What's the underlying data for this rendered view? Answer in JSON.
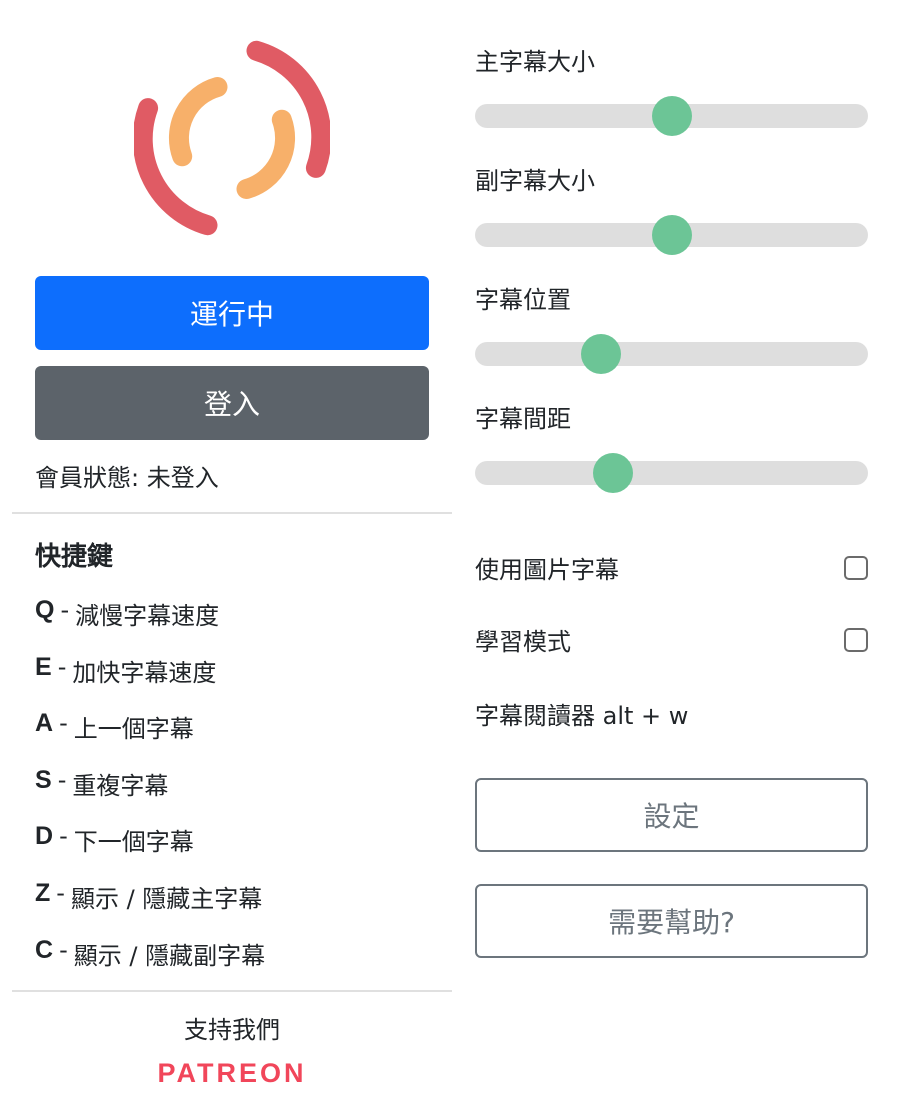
{
  "buttons": {
    "run_label": "運行中",
    "login_label": "登入"
  },
  "member": {
    "label": "會員狀態:",
    "value": "未登入"
  },
  "shortcuts": {
    "title": "快捷鍵",
    "items": [
      {
        "key": "Q",
        "desc": "減慢字幕速度"
      },
      {
        "key": "E",
        "desc": "加快字幕速度"
      },
      {
        "key": "A",
        "desc": "上一個字幕"
      },
      {
        "key": "S",
        "desc": "重複字幕"
      },
      {
        "key": "D",
        "desc": "下一個字幕"
      },
      {
        "key": "Z",
        "desc": "顯示 / 隱藏主字幕"
      },
      {
        "key": "C",
        "desc": "顯示 / 隱藏副字幕"
      }
    ]
  },
  "support": {
    "text": "支持我們",
    "brand": "PATREON"
  },
  "sliders": [
    {
      "label": "主字幕大小",
      "value": 0.5
    },
    {
      "label": "副字幕大小",
      "value": 0.5
    },
    {
      "label": "字幕位置",
      "value": 0.32
    },
    {
      "label": "字幕間距",
      "value": 0.35
    }
  ],
  "options": {
    "image_subtitle": {
      "label": "使用圖片字幕",
      "checked": false
    },
    "learning_mode": {
      "label": "學習模式",
      "checked": false
    },
    "reader_label": "字幕閱讀器 alt + w"
  },
  "right_buttons": {
    "settings_label": "設定",
    "help_label": "需要幫助?"
  },
  "colors": {
    "primary": "#0d6efd",
    "secondary": "#5c636a",
    "slider_thumb": "#6cc596",
    "slider_track": "#dedede",
    "logo_red": "#e05b64",
    "logo_orange": "#f7b06a",
    "patreon": "#f1465a"
  },
  "icons": {
    "logo": "app-logo-icon"
  }
}
